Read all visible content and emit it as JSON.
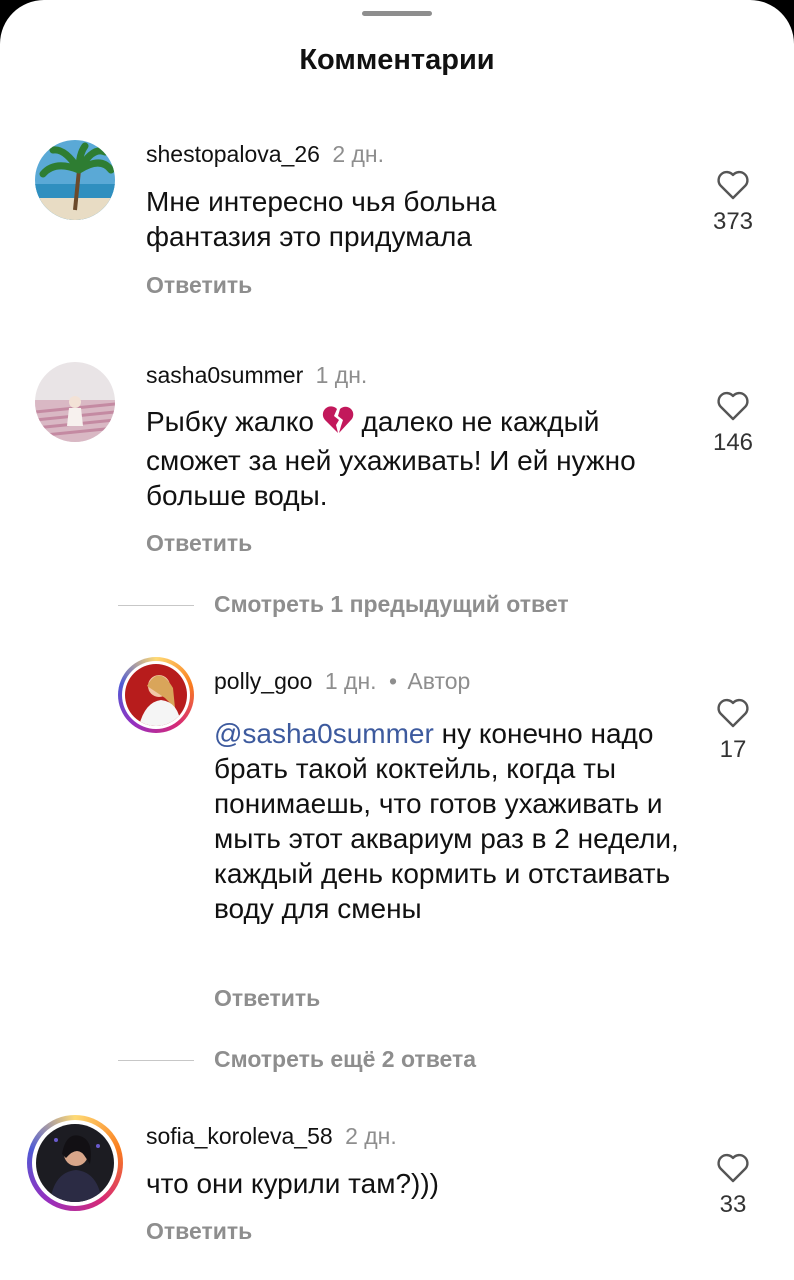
{
  "sheet": {
    "title": "Комментарии"
  },
  "comments": [
    {
      "username": "shestopalova_26",
      "time": "2 дн.",
      "text": "Мне интересно чья больна фантазия это придумала",
      "likes": "373",
      "reply_label": "Ответить"
    },
    {
      "username": "sasha0summer",
      "time": "1 дн.",
      "text_before_emoji": "Рыбку жалко",
      "emoji": "broken-heart-icon",
      "text_after_emoji": "далеко не каждый сможет за ней ухаживать! И ей нужно больше воды.",
      "likes": "146",
      "reply_label": "Ответить"
    },
    {
      "username": "polly_goo",
      "time": "1 дн.",
      "separator": "•",
      "author_badge": "Автор",
      "mention": "@sasha0summer",
      "text": "ну конечно надо брать такой коктейль, когда ты понимаешь, что готов ухаживать и мыть этот аквариум раз в 2 недели, каждый день кормить и отстаивать воду для смены",
      "likes": "17",
      "reply_label": "Ответить"
    },
    {
      "username": "sofia_koroleva_58",
      "time": "2 дн.",
      "text": "что они курили там?)))",
      "likes": "33",
      "reply_label": "Ответить"
    }
  ],
  "threads": {
    "view_previous": "Смотреть 1 предыдущий ответ",
    "view_more": "Смотреть ещё 2 ответа"
  },
  "colors": {
    "mention": "#3d5a9e",
    "muted": "#8e8e8e",
    "heart_break": "#c2185b"
  }
}
